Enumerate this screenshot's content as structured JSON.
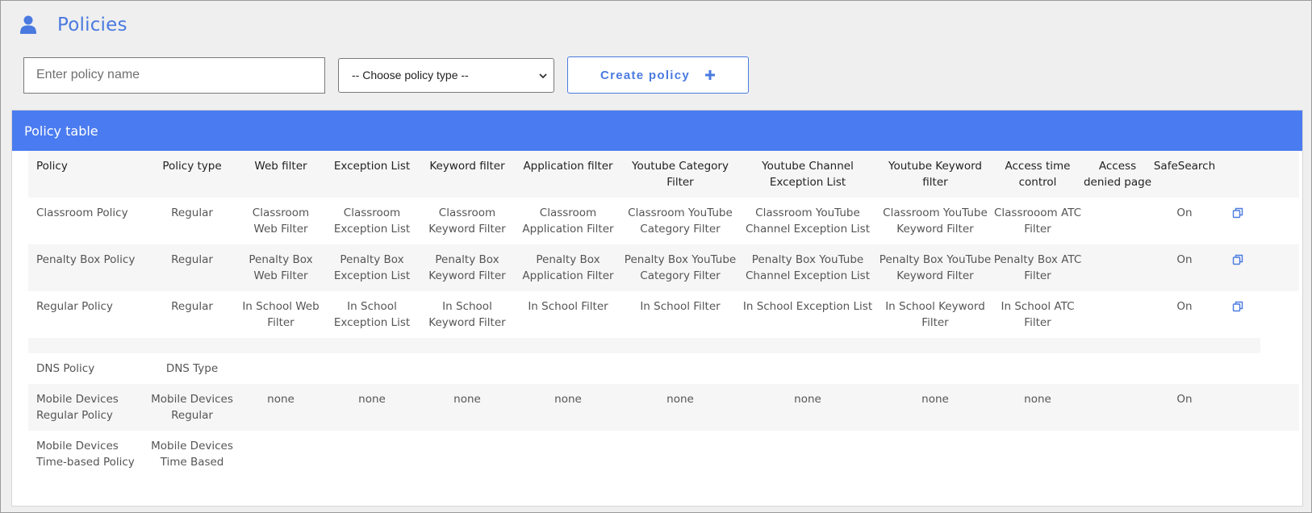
{
  "page": {
    "title": "Policies",
    "accent": "#4a7ae0"
  },
  "toolbar": {
    "name_placeholder": "Enter policy name",
    "type_select_value": "-- Choose policy type --",
    "create_label": "Create policy"
  },
  "table": {
    "title": "Policy table",
    "header_color": "#4a7bf0",
    "columns": [
      "Policy",
      "Policy type",
      "Web filter",
      "Exception List",
      "Keyword filter",
      "Application filter",
      "Youtube Category Filter",
      "Youtube Channel Exception List",
      "Youtube Keyword filter",
      "Access time control",
      "Access denied page",
      "SafeSearch"
    ],
    "rows": [
      [
        "Classroom Policy",
        "Regular",
        "Classroom Web Filter",
        "Classroom Exception List",
        "Classroom Keyword Filter",
        "Classroom Application Filter",
        "Classroom YouTube Category Filter",
        "Classroom YouTube Channel Exception List",
        "Classroom YouTube Keyword Filter",
        "Classrooom ATC Filter",
        "",
        "On"
      ],
      [
        "Penalty Box Policy",
        "Regular",
        "Penalty Box Web Filter",
        "Penalty Box Exception List",
        "Penalty Box Keyword Filter",
        "Penalty Box Application Filter",
        "Penalty Box YouTube Category Filter",
        "Penalty Box YouTube Channel Exception List",
        "Penalty Box YouTube Keyword Filter",
        "Penalty Box ATC Filter",
        "",
        "On"
      ],
      [
        "Regular Policy",
        "Regular",
        "In School Web Filter",
        "In School Exception List",
        "In School Keyword Filter",
        "In School Filter",
        "In School Filter",
        "In School Exception List",
        "In School Keyword Filter",
        "In School ATC Filter",
        "",
        "On"
      ]
    ],
    "other_rows": [
      [
        "DNS Policy",
        "DNS Type",
        "",
        "",
        "",
        "",
        "",
        "",
        "",
        "",
        "",
        ""
      ],
      [
        "Mobile Devices Regular Policy",
        "Mobile Devices Regular",
        "none",
        "none",
        "none",
        "none",
        "none",
        "none",
        "none",
        "none",
        "",
        "On"
      ],
      [
        "Mobile Devices Time-based Policy",
        "Mobile Devices Time Based",
        "",
        "",
        "",
        "",
        "",
        "",
        "",
        "",
        "",
        ""
      ]
    ]
  },
  "icons": {
    "header": "user-icon",
    "create": "plus-icon",
    "copy": "copy-icon",
    "select": "chevron-down-icon"
  }
}
